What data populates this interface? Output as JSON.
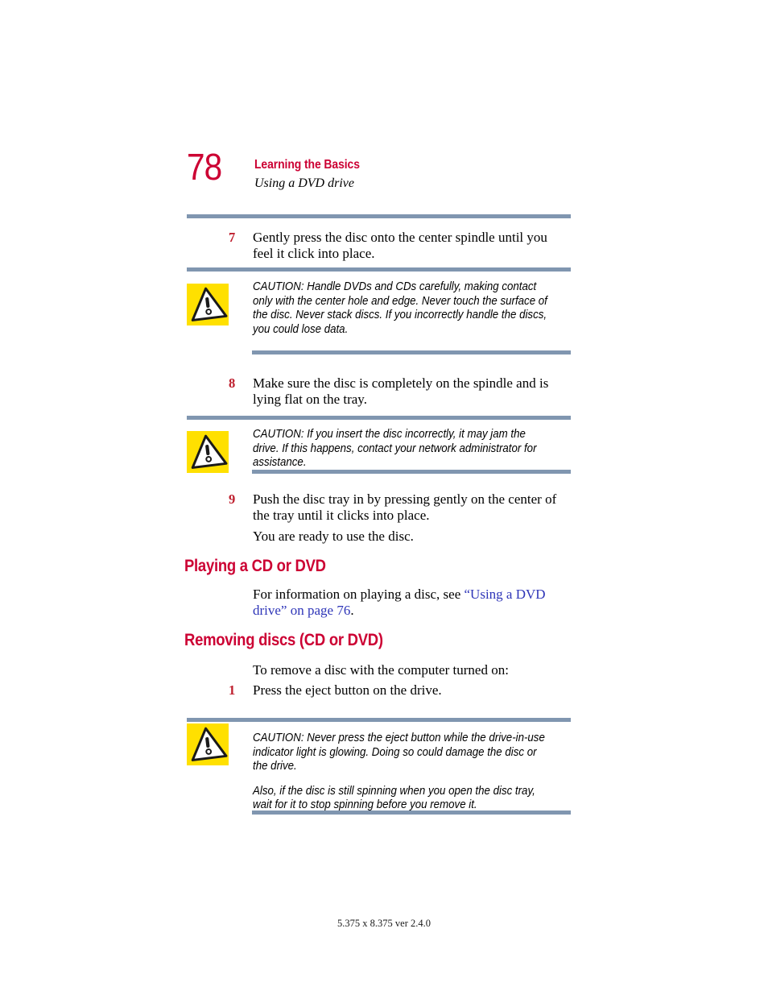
{
  "page": {
    "number": "78",
    "header_title": "Learning the Basics",
    "header_subtitle": "Using a DVD drive",
    "footer": "5.375 x 8.375 ver 2.4.0"
  },
  "colors": {
    "heading_red": "#CC0033",
    "step_number_red": "#BE1E2D",
    "rule_blue_gray": "#8096B0",
    "link_blue": "#2E35B8",
    "caution_yellow": "#FFE000"
  },
  "steps": {
    "step7": {
      "number": "7",
      "text": "Gently press the disc onto the center spindle until you feel it click into place."
    },
    "step8": {
      "number": "8",
      "text": "Make sure the disc is completely on the spindle and is lying flat on the tray."
    },
    "step9": {
      "number": "9",
      "text": "Push the disc tray in by pressing gently on the center of the tray until it clicks into place."
    },
    "step9_followup": "You are ready to use the disc.",
    "step_remove_1": {
      "number": "1",
      "text": "Press the eject button on the drive."
    }
  },
  "cautions": {
    "caution1": {
      "icon": "caution-triangle-icon",
      "paragraph1": "CAUTION: Handle DVDs and CDs carefully, making contact only with the center hole and edge. Never touch the surface of the disc. Never stack discs. If you incorrectly handle the discs, you could lose data."
    },
    "caution2": {
      "icon": "caution-triangle-icon",
      "paragraph1": "CAUTION: If you insert the disc incorrectly, it may jam the drive. If this happens, contact your network administrator for assistance."
    },
    "caution3": {
      "icon": "caution-triangle-icon",
      "paragraph1": "CAUTION: Never press the eject button while the drive-in-use indicator light is glowing. Doing so could damage the disc or the drive.",
      "paragraph2": "Also, if the disc is still spinning when you open the disc tray, wait for it to stop spinning before you remove it."
    }
  },
  "sections": {
    "playing": {
      "heading": "Playing a CD or DVD",
      "body_before_link": "For information on playing a disc, see ",
      "link_text": "“Using a DVD drive” on page 76",
      "body_after_link": "."
    },
    "removing": {
      "heading": "Removing discs (CD or DVD)",
      "intro": "To remove a disc with the computer turned on:"
    }
  }
}
